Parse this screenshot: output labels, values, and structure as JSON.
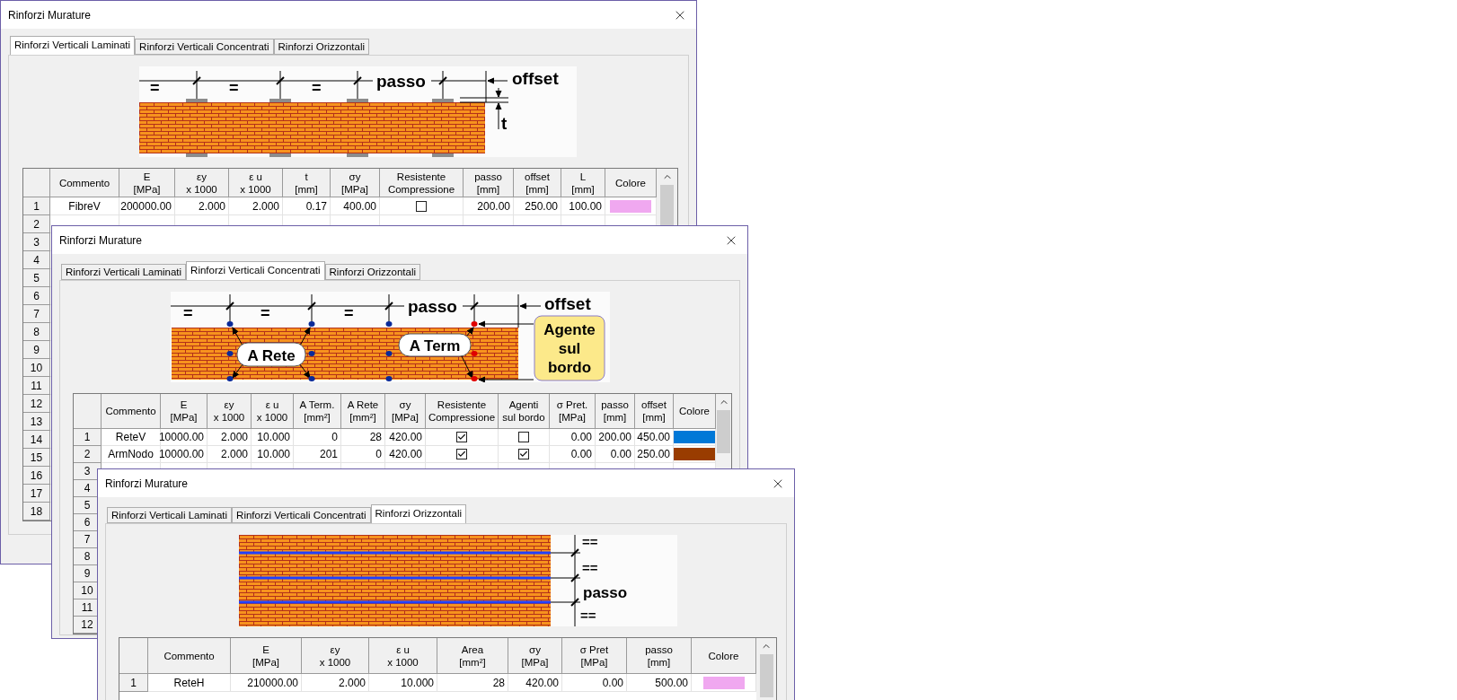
{
  "windows": [
    {
      "title": "Rinforzi Murature",
      "tabs": [
        {
          "label": "Rinforzi Verticali Laminati",
          "selected": true
        },
        {
          "label": "Rinforzi Verticali Concentrati",
          "selected": false
        },
        {
          "label": "Rinforzi Orizzontali",
          "selected": false
        }
      ],
      "diagram": {
        "kind": "laminati",
        "labels": [
          "=",
          "=",
          "=",
          "passo",
          "offset",
          "t"
        ]
      },
      "table": {
        "columns": [
          "Commento",
          "E\n[MPa]",
          "εy\nx 1000",
          "ε u\nx 1000",
          "t\n[mm]",
          "σy\n[MPa]",
          "Resistente\nCompressione",
          "passo\n[mm]",
          "offset\n[mm]",
          "L\n[mm]",
          "Colore"
        ],
        "rows": [
          {
            "number": "1",
            "cells": [
              {
                "kind": "name",
                "value": "FibreV"
              },
              {
                "kind": "number",
                "value": "200000.00"
              },
              {
                "kind": "number",
                "value": "2.000"
              },
              {
                "kind": "number",
                "value": "2.000"
              },
              {
                "kind": "number",
                "value": "0.17"
              },
              {
                "kind": "number",
                "value": "400.00"
              },
              {
                "kind": "checkbox",
                "checked": false
              },
              {
                "kind": "number",
                "value": "200.00"
              },
              {
                "kind": "number",
                "value": "250.00"
              },
              {
                "kind": "number",
                "value": "100.00"
              },
              {
                "kind": "color",
                "color": "#f0a8f0"
              }
            ]
          },
          {
            "number": "2"
          },
          {
            "number": "3"
          },
          {
            "number": "4"
          },
          {
            "number": "5"
          },
          {
            "number": "6"
          },
          {
            "number": "7"
          },
          {
            "number": "8"
          },
          {
            "number": "9"
          },
          {
            "number": "10"
          },
          {
            "number": "11"
          },
          {
            "number": "12"
          },
          {
            "number": "13"
          },
          {
            "number": "14"
          },
          {
            "number": "15"
          },
          {
            "number": "16"
          },
          {
            "number": "17"
          },
          {
            "number": "18"
          }
        ]
      }
    },
    {
      "title": "Rinforzi Murature",
      "tabs": [
        {
          "label": "Rinforzi Verticali Laminati",
          "selected": false
        },
        {
          "label": "Rinforzi Verticali Concentrati",
          "selected": true
        },
        {
          "label": "Rinforzi Orizzontali",
          "selected": false
        }
      ],
      "diagram": {
        "kind": "concentrati",
        "labels": [
          "=",
          "=",
          "=",
          "passo",
          "offset",
          "A Rete",
          "A Term",
          "Agente sul bordo"
        ]
      },
      "table": {
        "columns": [
          "Commento",
          "E\n[MPa]",
          "εy\nx 1000",
          "ε u\nx 1000",
          "A Term.\n[mm²]",
          "A Rete\n[mm²]",
          "σy\n[MPa]",
          "Resistente\nCompressione",
          "Agenti\nsul bordo",
          "σ Pret.\n[MPa]",
          "passo\n[mm]",
          "offset\n[mm]",
          "Colore"
        ],
        "rows": [
          {
            "number": "1",
            "cells": [
              {
                "kind": "name",
                "value": "ReteV"
              },
              {
                "kind": "number",
                "value": "10000.00"
              },
              {
                "kind": "number",
                "value": "2.000"
              },
              {
                "kind": "number",
                "value": "10.000"
              },
              {
                "kind": "number",
                "value": "0"
              },
              {
                "kind": "number",
                "value": "28"
              },
              {
                "kind": "number",
                "value": "420.00"
              },
              {
                "kind": "checkbox",
                "checked": true
              },
              {
                "kind": "checkbox",
                "checked": false
              },
              {
                "kind": "number",
                "value": "0.00"
              },
              {
                "kind": "number",
                "value": "200.00"
              },
              {
                "kind": "number",
                "value": "450.00"
              },
              {
                "kind": "color",
                "color": "#0078d7"
              }
            ]
          },
          {
            "number": "2",
            "cells": [
              {
                "kind": "name",
                "value": "ArmNodo"
              },
              {
                "kind": "number",
                "value": "10000.00"
              },
              {
                "kind": "number",
                "value": "2.000"
              },
              {
                "kind": "number",
                "value": "10.000"
              },
              {
                "kind": "number",
                "value": "201"
              },
              {
                "kind": "number",
                "value": "0"
              },
              {
                "kind": "number",
                "value": "420.00"
              },
              {
                "kind": "checkbox",
                "checked": true
              },
              {
                "kind": "checkbox",
                "checked": true
              },
              {
                "kind": "number",
                "value": "0.00"
              },
              {
                "kind": "number",
                "value": "0.00"
              },
              {
                "kind": "number",
                "value": "250.00"
              },
              {
                "kind": "color",
                "color": "#993c00"
              }
            ]
          },
          {
            "number": "3"
          },
          {
            "number": "4"
          },
          {
            "number": "5"
          },
          {
            "number": "6"
          },
          {
            "number": "7"
          },
          {
            "number": "8"
          },
          {
            "number": "9"
          },
          {
            "number": "10"
          },
          {
            "number": "11"
          },
          {
            "number": "12"
          }
        ]
      }
    },
    {
      "title": "Rinforzi Murature",
      "tabs": [
        {
          "label": "Rinforzi Verticali Laminati",
          "selected": false
        },
        {
          "label": "Rinforzi Verticali Concentrati",
          "selected": false
        },
        {
          "label": "Rinforzi Orizzontali",
          "selected": true
        }
      ],
      "diagram": {
        "kind": "orizzontali",
        "labels": [
          "==",
          "==",
          "passo",
          "=="
        ]
      },
      "table": {
        "columns": [
          "Commento",
          "E\n[MPa]",
          "εy\nx 1000",
          "ε u\nx 1000",
          "Area\n[mm²]",
          "σy\n[MPa]",
          "σ Pret\n[MPa]",
          "passo\n[mm]",
          "Colore"
        ],
        "rows": [
          {
            "number": "1",
            "cells": [
              {
                "kind": "name",
                "value": "ReteH"
              },
              {
                "kind": "number",
                "value": "210000.00"
              },
              {
                "kind": "number",
                "value": "2.000"
              },
              {
                "kind": "number",
                "value": "10.000"
              },
              {
                "kind": "number",
                "value": "28"
              },
              {
                "kind": "number",
                "value": "420.00"
              },
              {
                "kind": "number",
                "value": "0.00"
              },
              {
                "kind": "number",
                "value": "500.00"
              },
              {
                "kind": "color",
                "color": "#f0a8f0"
              }
            ]
          }
        ]
      }
    }
  ]
}
